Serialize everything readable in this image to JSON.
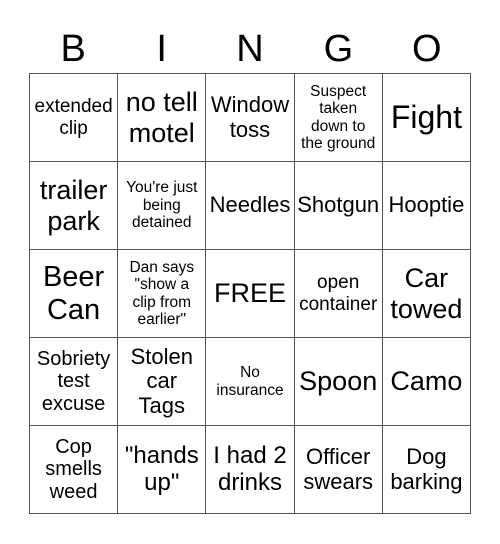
{
  "header": [
    "B",
    "I",
    "N",
    "G",
    "O"
  ],
  "cells": [
    [
      "extended\nclip",
      "no tell\nmotel",
      "Window\ntoss",
      "Suspect\ntaken\ndown to\nthe ground",
      "Fight"
    ],
    [
      "trailer\npark",
      "You're just\nbeing\ndetained",
      "Needles",
      "Shotgun",
      "Hooptie"
    ],
    [
      "Beer\nCan",
      "Dan says\n\"show a\nclip from\nearlier\"",
      "FREE",
      "open\ncontainer",
      "Car\ntowed"
    ],
    [
      "Sobriety\ntest\nexcuse",
      "Stolen\ncar\nTags",
      "No\ninsurance",
      "Spoon",
      "Camo"
    ],
    [
      "Cop\nsmells\nweed",
      "\"hands\nup\"",
      "I had 2\ndrinks",
      "Officer\nswears",
      "Dog\nbarking"
    ]
  ]
}
